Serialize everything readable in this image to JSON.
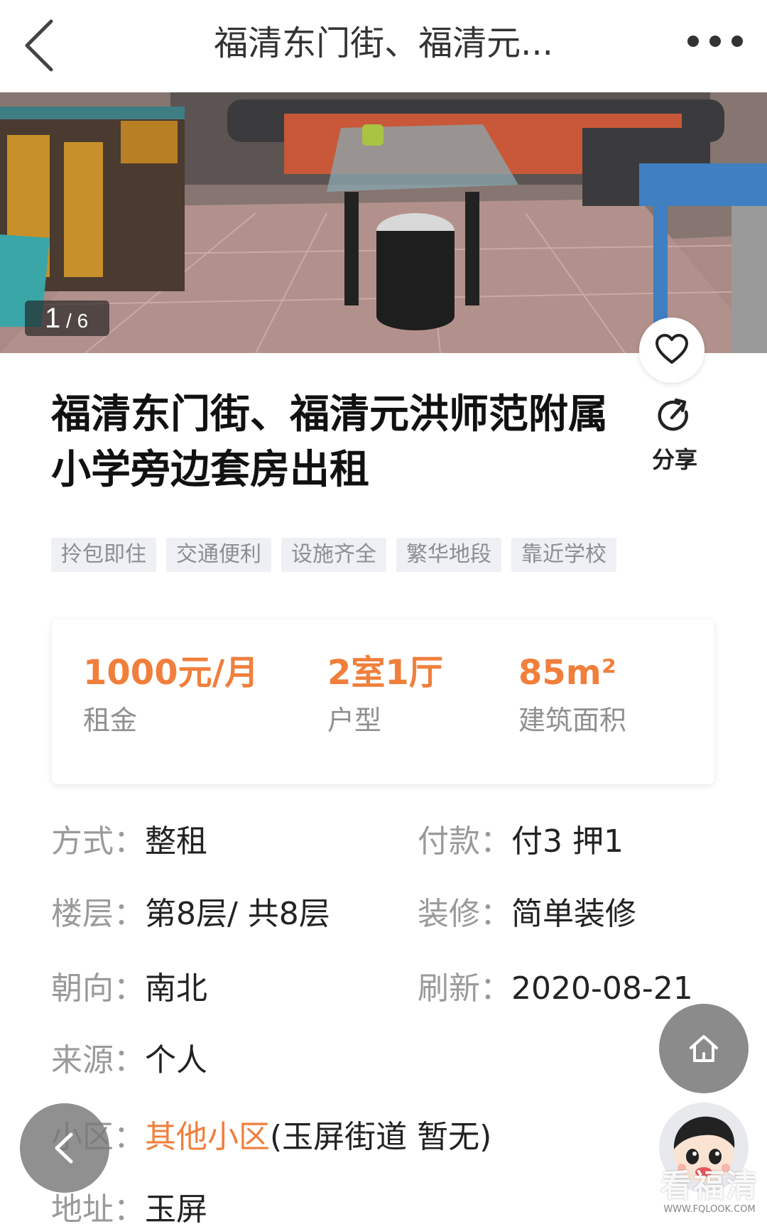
{
  "header": {
    "title": "福清东门街、福清元...",
    "back_icon": "chevron-left-icon",
    "more_icon": "more-dots-icon"
  },
  "gallery": {
    "current": "1",
    "separator": " / ",
    "total": "6"
  },
  "listing": {
    "title": "福清东门街、福清元洪师范附属小学旁边套房出租",
    "share_label": "分享",
    "favorite_icon": "heart-icon",
    "share_icon": "share-arrow-icon"
  },
  "tags": [
    "拎包即住",
    "交通便利",
    "设施齐全",
    "繁华地段",
    "靠近学校"
  ],
  "stats": [
    {
      "value": "1000元/月",
      "label": "租金"
    },
    {
      "value": "2室1厅",
      "label": "户型"
    },
    {
      "value": "85m²",
      "label": "建筑面积"
    }
  ],
  "details": {
    "method": {
      "key": "方式：",
      "value": "整租"
    },
    "payment": {
      "key": "付款：",
      "value": "付3 押1"
    },
    "floor": {
      "key": "楼层：",
      "value": "第8层/ 共8层"
    },
    "decoration": {
      "key": "装修：",
      "value": "简单装修"
    },
    "orientation": {
      "key": "朝向：",
      "value": "南北"
    },
    "refresh": {
      "key": "刷新：",
      "value": "2020-08-21"
    },
    "source": {
      "key": "来源：",
      "value": "个人"
    },
    "community": {
      "key": "小区：",
      "link": "其他小区",
      "value": "(玉屏街道 暂无)"
    },
    "address": {
      "key": "地址：",
      "value": "玉屏"
    }
  },
  "watermark": {
    "main": "看福清",
    "sub": "WWW.FQLOOK.COM"
  },
  "colors": {
    "accent": "#f07f3c",
    "muted_text": "#9a9a9a",
    "tag_bg": "#eef0f3"
  }
}
